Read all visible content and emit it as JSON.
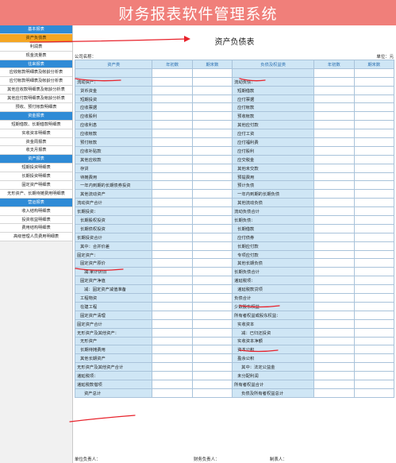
{
  "app_title": "财务报表软件管理系统",
  "sidebar": [
    {
      "label": "基本报表",
      "kind": "head"
    },
    {
      "label": "资产负债表",
      "kind": "item",
      "active": true
    },
    {
      "label": "利润表",
      "kind": "item"
    },
    {
      "label": "现金流量表",
      "kind": "item"
    },
    {
      "label": "往来报表",
      "kind": "head"
    },
    {
      "label": "应收帐款明细表及帐龄分析表",
      "kind": "item"
    },
    {
      "label": "应付帐款明细表及帐龄分析表",
      "kind": "item"
    },
    {
      "label": "其他应收款明细表及帐龄分析表",
      "kind": "item"
    },
    {
      "label": "其他应付款明细表及帐龄分析表",
      "kind": "item"
    },
    {
      "label": "预收、预付帐款明细表",
      "kind": "item"
    },
    {
      "label": "资金报表",
      "kind": "head"
    },
    {
      "label": "短期借款、长期借款明细表",
      "kind": "item"
    },
    {
      "label": "实收资本明细表",
      "kind": "item"
    },
    {
      "label": "资金周报表",
      "kind": "item"
    },
    {
      "label": "收支月报表",
      "kind": "item"
    },
    {
      "label": "资产报表",
      "kind": "head"
    },
    {
      "label": "短期投资明细表",
      "kind": "item"
    },
    {
      "label": "长期投资明细表",
      "kind": "item"
    },
    {
      "label": "固定资产明细表",
      "kind": "item"
    },
    {
      "label": "无形资产、长期待摊费用明细表",
      "kind": "item"
    },
    {
      "label": "营运报表",
      "kind": "head"
    },
    {
      "label": "收入结构明细表",
      "kind": "item"
    },
    {
      "label": "投资收益明细表",
      "kind": "item"
    },
    {
      "label": "费用结构明细表",
      "kind": "item"
    },
    {
      "label": "高级管理人员费用明细表",
      "kind": "item"
    }
  ],
  "report": {
    "title": "资产负债表",
    "company_label": "公司名称：",
    "unit_label": "单位：元",
    "headers": [
      "资产类",
      "年初数",
      "期末数",
      "负债及权益类",
      "年初数",
      "期末数"
    ],
    "rows": [
      [
        [
          "",
          0,
          false
        ],
        [
          "",
          0,
          false
        ]
      ],
      [
        [
          "流动资产：",
          0,
          false
        ],
        [
          "流动负债：",
          0,
          false
        ]
      ],
      [
        [
          "货币资金",
          1,
          false
        ],
        [
          "短期借款",
          1,
          false
        ]
      ],
      [
        [
          "短期投资",
          1,
          false
        ],
        [
          "应付票据",
          1,
          false
        ]
      ],
      [
        [
          "应收票据",
          1,
          false
        ],
        [
          "应付帐款",
          1,
          false
        ]
      ],
      [
        [
          "应收股利",
          1,
          false
        ],
        [
          "预收帐款",
          1,
          false
        ]
      ],
      [
        [
          "应收利息",
          1,
          false
        ],
        [
          "其他应付款",
          1,
          false
        ]
      ],
      [
        [
          "应收帐款",
          1,
          false
        ],
        [
          "应付工资",
          1,
          false
        ]
      ],
      [
        [
          "预付帐款",
          1,
          false
        ],
        [
          "应付福利费",
          1,
          false
        ]
      ],
      [
        [
          "应收补贴款",
          1,
          false
        ],
        [
          "应付股利",
          1,
          false
        ]
      ],
      [
        [
          "其他应收款",
          1,
          false
        ],
        [
          "应交税金",
          1,
          false
        ]
      ],
      [
        [
          "存货",
          1,
          false
        ],
        [
          "其他未交款",
          1,
          false
        ]
      ],
      [
        [
          "待摊费用",
          1,
          false
        ],
        [
          "预提费用",
          1,
          false
        ]
      ],
      [
        [
          "一年内到期的长期债券投资",
          1,
          false
        ],
        [
          "预计负债",
          1,
          false
        ]
      ],
      [
        [
          "其他流动资产",
          1,
          false
        ],
        [
          "一年内到期的长期负债",
          1,
          false
        ]
      ],
      [
        [
          "流动资产合计",
          0,
          true
        ],
        [
          "其他流动负债",
          1,
          false
        ]
      ],
      [
        [
          "长期投资：",
          0,
          false
        ],
        [
          "流动负债合计",
          0,
          true
        ]
      ],
      [
        [
          "长期股权投资",
          1,
          false
        ],
        [
          "长期负债：",
          0,
          false
        ]
      ],
      [
        [
          "长期债权投资",
          1,
          false
        ],
        [
          "长期借款",
          1,
          false
        ]
      ],
      [
        [
          "长期投资合计",
          0,
          true
        ],
        [
          "应付债券",
          1,
          false
        ]
      ],
      [
        [
          "其中：合并价差",
          1,
          false
        ],
        [
          "长期应付款",
          1,
          false
        ]
      ],
      [
        [
          "固定资产：",
          0,
          false
        ],
        [
          "专项应付款",
          1,
          false
        ]
      ],
      [
        [
          "固定资产原价",
          1,
          false
        ],
        [
          "其他长期负债",
          1,
          false
        ]
      ],
      [
        [
          "减:累计折旧",
          2,
          false
        ],
        [
          "长期负债合计",
          0,
          true
        ]
      ],
      [
        [
          "固定资产净值",
          1,
          false
        ],
        [
          "递延税项：",
          0,
          false
        ]
      ],
      [
        [
          "减：固定资产减值准备",
          2,
          false
        ],
        [
          "递延税款贷项",
          1,
          true
        ]
      ],
      [
        [
          "工程物资",
          1,
          false
        ],
        [
          "负债合计",
          0,
          true
        ]
      ],
      [
        [
          "在建工程",
          1,
          false
        ],
        [
          "少数股东权益",
          0,
          true
        ]
      ],
      [
        [
          "固定资产清理",
          1,
          false
        ],
        [
          "所有者权益或股东权益：",
          0,
          false
        ]
      ],
      [
        [
          "固定资产合计",
          0,
          true
        ],
        [
          "实收资本",
          1,
          false
        ]
      ],
      [
        [
          "无形资产及其他资产：",
          0,
          false
        ],
        [
          "减：已归还投资",
          2,
          false
        ]
      ],
      [
        [
          "无形资产",
          1,
          false
        ],
        [
          "实收资本净额",
          1,
          false
        ]
      ],
      [
        [
          "长期待摊费用",
          1,
          false
        ],
        [
          "资本公积",
          1,
          false
        ]
      ],
      [
        [
          "其他长期资产",
          1,
          false
        ],
        [
          "盈余公积",
          1,
          false
        ]
      ],
      [
        [
          "无形资产及其他资产合计",
          0,
          true
        ],
        [
          "其中：法定公益金",
          2,
          false
        ]
      ],
      [
        [
          "递延税项：",
          0,
          false
        ],
        [
          "未分配利润",
          1,
          false
        ]
      ],
      [
        [
          "递延税款借项",
          0,
          true
        ],
        [
          "所有者权益合计",
          0,
          true
        ]
      ],
      [
        [
          "资产总计",
          2,
          true
        ],
        [
          "负债及所有者权益总计",
          2,
          true
        ]
      ]
    ],
    "footer": {
      "unit_head": "单位负责人：",
      "finance_head": "财务负责人：",
      "preparer": "制表人："
    }
  },
  "colors": {
    "title_bar": "#f07f7a",
    "section_head": "#2f8bd6",
    "active_item": "#f5a623",
    "label_cell": "#cfe6f5",
    "annotation": "#e8222b"
  },
  "icons": [
    "arrow-right-annotation-icon"
  ]
}
